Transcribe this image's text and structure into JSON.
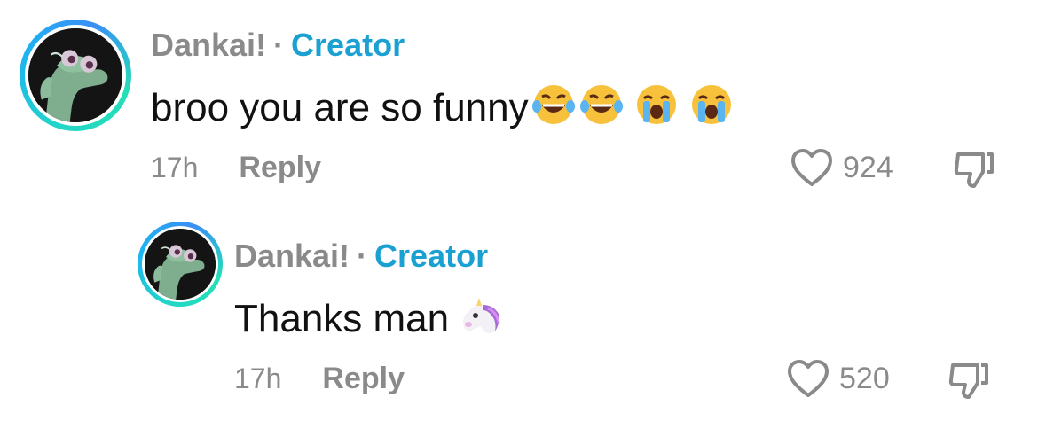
{
  "comments": [
    {
      "author": "Dankai!",
      "separator": "·",
      "badge": "Creator",
      "text": "broo you are so funny",
      "emojis": [
        "joy-emoji",
        "joy-emoji",
        "sob-emoji",
        "sob-emoji"
      ],
      "time": "17h",
      "reply_label": "Reply",
      "likes": "924",
      "avatar": "lizard-avatar"
    },
    {
      "author": "Dankai!",
      "separator": "·",
      "badge": "Creator",
      "text": "Thanks man",
      "emojis": [
        "unicorn-emoji"
      ],
      "time": "17h",
      "reply_label": "Reply",
      "likes": "520",
      "avatar": "lizard-avatar"
    }
  ],
  "colors": {
    "author": "#8a8a8a",
    "badge": "#1aa1d2",
    "text": "#111111",
    "meta": "#8a8a8a",
    "ring_start": "#23d5c8",
    "ring_end": "#1db4f0"
  }
}
